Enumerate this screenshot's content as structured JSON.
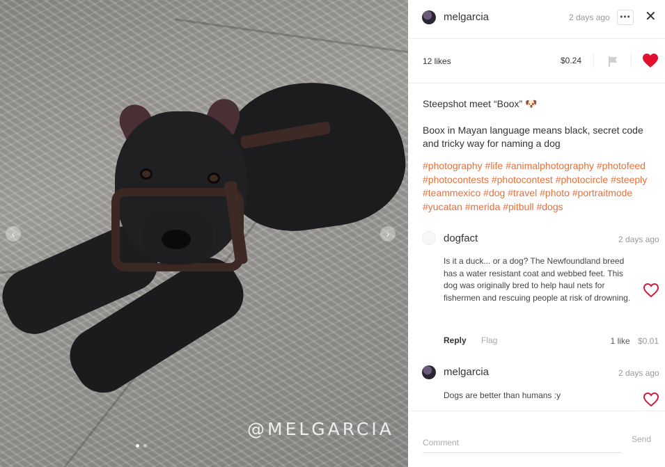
{
  "photo": {
    "watermark": "@MELGARCIA",
    "prev_arrow": "‹",
    "next_arrow": "›"
  },
  "header": {
    "username": "melgarcia",
    "time_ago": "2 days ago",
    "more_label": "•••",
    "close_label": "✕"
  },
  "stats": {
    "likes": "12 likes",
    "payout": "$0.24",
    "liked": true,
    "heart_color": "#e0102e"
  },
  "post": {
    "title": "Steepshot meet “Boox” 🐶",
    "body": "Boox in Mayan language means black, secret code and tricky way for naming a dog",
    "tags": [
      "#photography",
      "#life",
      "#animalphotography",
      "#photofeed",
      "#photocontests",
      "#photocontest",
      "#photocircle",
      "#steeply",
      "#teammexico",
      "#dog",
      "#travel",
      "#photo",
      "#portraitmode",
      "#yucatan",
      "#merida",
      "#pitbull",
      "#dogs"
    ],
    "tag_color": "#e8703b"
  },
  "comments": [
    {
      "username": "dogfact",
      "time_ago": "2 days ago",
      "text": "Is it a duck... or a dog? The Newfoundland breed has a water resistant coat and webbed feet. This dog was originally bred to help haul nets for fishermen and rescuing people at risk of drowning.",
      "reply_label": "Reply",
      "flag_label": "Flag",
      "likes": "1 like",
      "payout": "$0.01"
    },
    {
      "username": "melgarcia",
      "time_ago": "2 days ago",
      "text": "Dogs are better than humans :y"
    }
  ],
  "footer": {
    "comment_placeholder": "Comment",
    "send_label": "Send"
  }
}
